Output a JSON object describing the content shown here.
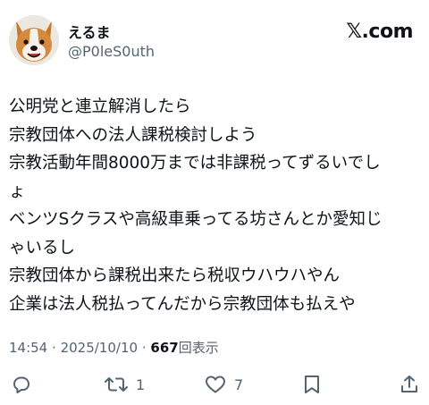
{
  "author": {
    "display_name": "えるま",
    "handle": "@P0leS0uth"
  },
  "brand": {
    "logo_text": "𝕏.com"
  },
  "tweet": {
    "lines": [
      "公明党と連立解消したら",
      "宗教団体への法人課税検討しよう",
      "宗教活動年間8000万までは非課税ってずるいでし",
      "ょ",
      "ベンツSクラスや高級車乗ってる坊さんとか愛知じ",
      "ゃいるし",
      "宗教団体から課税出来たら税収ウハウハやん",
      "企業は法人税払ってんだから宗教団体も払えや"
    ]
  },
  "meta": {
    "time": "14:54",
    "separator": "·",
    "date": "2025/10/10",
    "views_count": "667",
    "views_label": "回表示"
  },
  "actions": {
    "reply": {
      "icon": "reply-icon"
    },
    "retweet": {
      "icon": "retweet-icon",
      "count": "1"
    },
    "like": {
      "icon": "heart-icon",
      "count": "7"
    },
    "bookmark": {
      "icon": "bookmark-icon"
    },
    "share": {
      "icon": "share-icon"
    }
  },
  "colors": {
    "text": "#0f1419",
    "secondary": "#536471",
    "background": "#ffffff"
  }
}
